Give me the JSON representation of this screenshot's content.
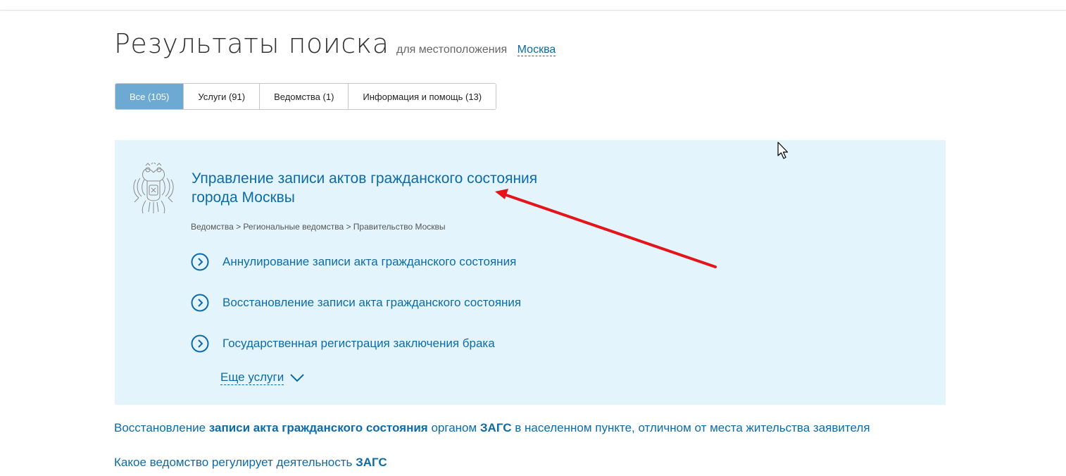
{
  "header": {
    "title": "Результаты поиска",
    "location_prefix": "для местоположения",
    "location": "Москва"
  },
  "tabs": [
    {
      "label": "Все (105)",
      "active": true
    },
    {
      "label": "Услуги (91)",
      "active": false
    },
    {
      "label": "Ведомства (1)",
      "active": false
    },
    {
      "label": "Информация и помощь (13)",
      "active": false
    }
  ],
  "agency": {
    "title": "Управление записи актов гражданского состояния города Москвы",
    "emblem_icon": "russian-coat-of-arms-icon",
    "breadcrumb": "Ведомства > Региональные ведомства > Правительство Москвы",
    "services": [
      "Аннулирование записи акта гражданского состояния",
      "Восстановление записи акта гражданского состояния",
      "Государственная регистрация заключения брака"
    ],
    "more_label": "Еще услуги"
  },
  "results": [
    {
      "parts": [
        "Восстановление ",
        "записи акта гражданского состояния",
        " органом ",
        "ЗАГС",
        " в населенном пункте, отличном от места жительства заявителя"
      ]
    },
    {
      "parts": [
        "Какое ведомство регулирует деятельность ",
        "ЗАГС"
      ]
    }
  ],
  "colors": {
    "link": "#0d6ba8",
    "card_bg": "#e4f4fc",
    "tab_active": "#6ca9d3",
    "annotation_arrow": "#e3151a"
  }
}
